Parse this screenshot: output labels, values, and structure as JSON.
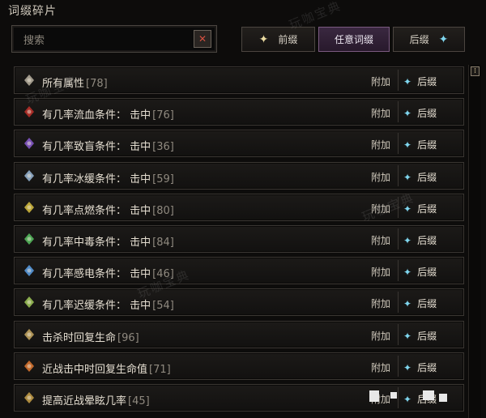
{
  "title": "词缀碎片",
  "search": {
    "placeholder": "搜索"
  },
  "filters": [
    {
      "label": "前缀",
      "active": false
    },
    {
      "label": "任意词缀",
      "active": true
    },
    {
      "label": "后缀",
      "active": false
    }
  ],
  "rows": [
    {
      "name": "所有属性",
      "level": "[78]",
      "icon": "bone-icon",
      "color": "#b8b0a0"
    },
    {
      "name": "有几率流血条件：  击中",
      "level": "[76]",
      "icon": "blood-dagger-icon",
      "color": "#c0302a"
    },
    {
      "name": "有几率致盲条件：  击中",
      "level": "[36]",
      "icon": "purple-crystal-icon",
      "color": "#8a5ad0"
    },
    {
      "name": "有几率冰缓条件：  击中",
      "level": "[59]",
      "icon": "frost-crystal-icon",
      "color": "#9ab8d8"
    },
    {
      "name": "有几率点燃条件：  击中",
      "level": "[80]",
      "icon": "fire-feather-icon",
      "color": "#d8c040"
    },
    {
      "name": "有几率中毒条件：  击中",
      "level": "[84]",
      "icon": "poison-feather-icon",
      "color": "#58c060"
    },
    {
      "name": "有几率感电条件：  击中",
      "level": "[46]",
      "icon": "lightning-feather-icon",
      "color": "#5aa0e8"
    },
    {
      "name": "有几率迟缓条件：  击中",
      "level": "[54]",
      "icon": "green-herb-icon",
      "color": "#a0c858"
    },
    {
      "name": "击杀时回复生命",
      "level": "[96]",
      "icon": "skull-icon",
      "color": "#c8a860"
    },
    {
      "name": "近战击中时回复生命值",
      "level": "[71]",
      "icon": "orange-gem-icon",
      "color": "#e07830"
    },
    {
      "name": "提高近战晕眩几率",
      "level": "[45]",
      "icon": "gold-gem-icon",
      "color": "#c8a048"
    }
  ],
  "row_add_label": "附加",
  "row_suffix_label": "后缀",
  "watermark_text": "玩咖宝典"
}
